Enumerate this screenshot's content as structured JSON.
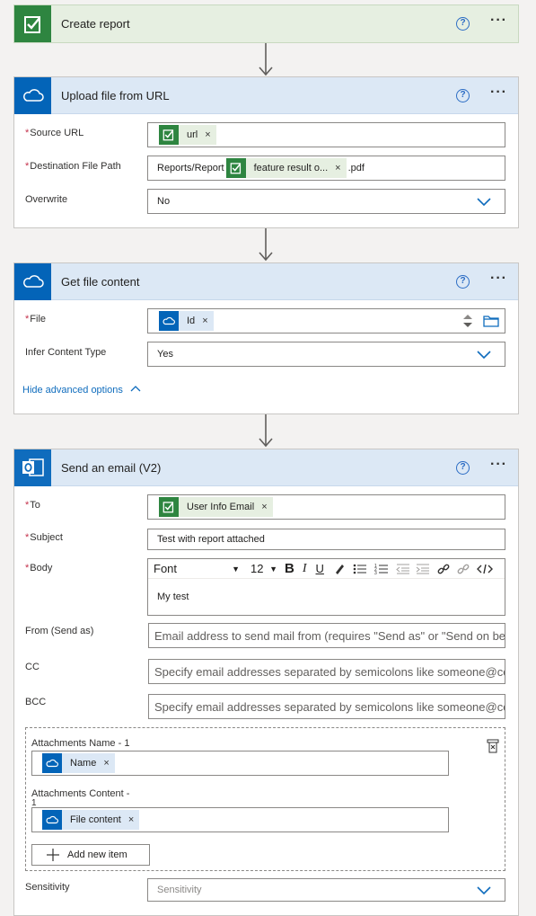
{
  "create_report": {
    "title": "Create report"
  },
  "upload": {
    "title": "Upload file from URL",
    "source_url": {
      "label": "Source URL",
      "token": "url"
    },
    "dest_path": {
      "label": "Destination File Path",
      "prefix": "Reports/Report",
      "token": "feature result o...",
      "suffix": ".pdf"
    },
    "overwrite": {
      "label": "Overwrite",
      "value": "No"
    }
  },
  "get_file": {
    "title": "Get file content",
    "file": {
      "label": "File",
      "token": "Id"
    },
    "infer": {
      "label": "Infer Content Type",
      "value": "Yes"
    },
    "advanced_link": "Hide advanced options"
  },
  "email": {
    "title": "Send an email (V2)",
    "to": {
      "label": "To",
      "token": "User Info Email"
    },
    "subject": {
      "label": "Subject",
      "value": "Test with report attached"
    },
    "body": {
      "label": "Body",
      "font": "Font",
      "size": "12",
      "content": "My test"
    },
    "from": {
      "label": "From (Send as)",
      "placeholder": "Email address to send mail from (requires \"Send as\" or \"Send on behalf of\" permission)"
    },
    "cc": {
      "label": "CC",
      "placeholder": "Specify email addresses separated by semicolons like someone@contoso.com"
    },
    "bcc": {
      "label": "BCC",
      "placeholder": "Specify email addresses separated by semicolons like someone@contoso.com"
    },
    "attach_name": {
      "label": "Attachments Name - 1",
      "token": "Name"
    },
    "attach_content": {
      "label": "Attachments Content -",
      "label2": "1",
      "token": "File content"
    },
    "add_item": "Add new item",
    "sensitivity": {
      "label": "Sensitivity",
      "placeholder": "Sensitivity"
    }
  },
  "icons": {
    "help": "?",
    "more": "···",
    "close": "×"
  }
}
